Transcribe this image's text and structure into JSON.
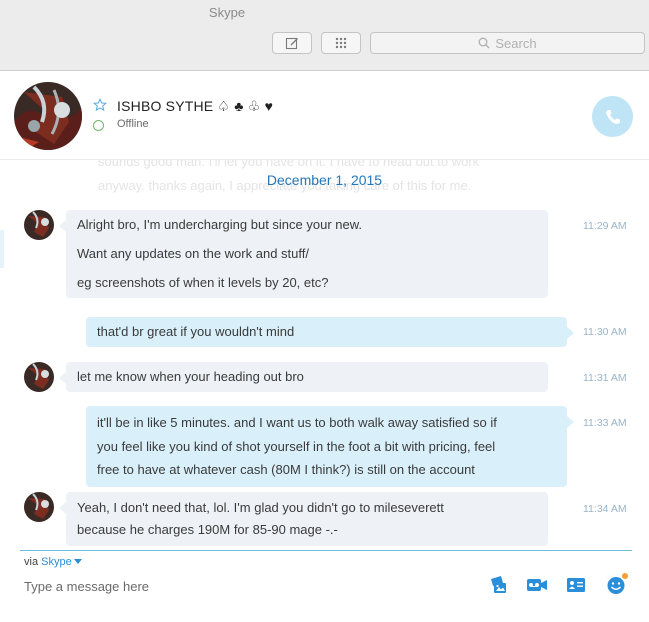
{
  "window": {
    "title": "Skype"
  },
  "toolbar": {
    "search_placeholder": "Search"
  },
  "contact": {
    "name": "ISHBO SYTHE ♤ ♣ ♧ ♥",
    "status": "Offline"
  },
  "conversation": {
    "faded_lines": [
      "sounds good man. I'll let you have on it. I have to head out to work",
      "anyway. thanks again, I appreciate you taking care of this for me."
    ],
    "date_separator": "December 1, 2015",
    "messages": [
      {
        "direction": "in",
        "lines": [
          "Alright bro, I'm undercharging but since your new.",
          "Want any updates on the work and stuff/",
          "eg screenshots of when it levels by 20, etc?"
        ],
        "time": "11:29 AM"
      },
      {
        "direction": "out",
        "lines": [
          "that'd br great if you wouldn't mind"
        ],
        "time": "11:30 AM"
      },
      {
        "direction": "in",
        "lines": [
          "let me know when your heading out bro"
        ],
        "time": "11:31 AM"
      },
      {
        "direction": "out",
        "lines": [
          "it'll be in like 5 minutes. and I want us to both walk away satisfied so if",
          "you feel like you kind of shot yourself in the foot a bit with pricing, feel",
          "free to have at whatever cash (80M I think?) is still on the account"
        ],
        "time": "11:33 AM"
      },
      {
        "direction": "in",
        "lines": [
          "Yeah, I don't need that, lol. I'm glad you didn't go to mileseverett",
          "because he charges 190M for 85-90 mage -.-"
        ],
        "time": "11:34 AM"
      }
    ]
  },
  "compose": {
    "via_label": "via",
    "via_service": "Skype",
    "placeholder": "Type a message here"
  },
  "colors": {
    "accent": "#2a8fd8",
    "incoming_bubble": "#eef2f6",
    "outgoing_bubble": "#d9f0fb",
    "call_button": "#bfe4f6",
    "online_ring": "#6fb66b"
  }
}
